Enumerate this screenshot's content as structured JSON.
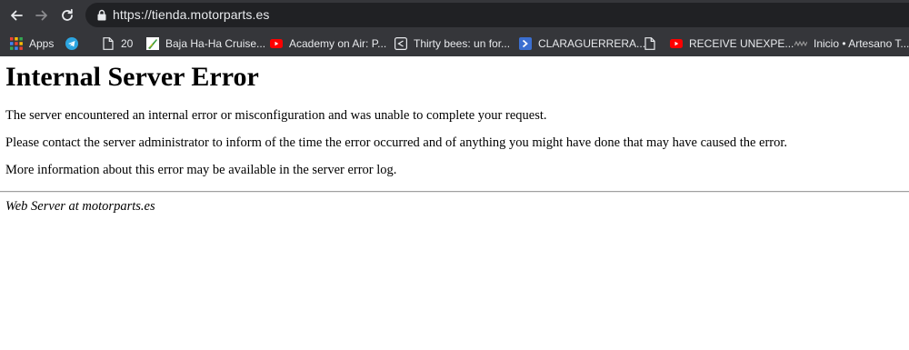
{
  "browser": {
    "url": "https://tienda.motorparts.es",
    "bookmarks": [
      {
        "label": "Apps",
        "icon": "apps-grid-icon"
      },
      {
        "label": "",
        "icon": "telegram-icon"
      },
      {
        "label": "20",
        "icon": "document-icon"
      },
      {
        "label": "Baja Ha-Ha Cruise...",
        "icon": "bajahaha-icon"
      },
      {
        "label": "Academy on Air: P...",
        "icon": "youtube-icon"
      },
      {
        "label": "Thirty bees: un for...",
        "icon": "share-icon"
      },
      {
        "label": "CLARAGUERRERA...",
        "icon": "chevron-icon"
      },
      {
        "label": "",
        "icon": "document-icon"
      },
      {
        "label": "RECEIVE UNEXPE...",
        "icon": "youtube-icon"
      },
      {
        "label": "Inicio • Artesano T...",
        "icon": "artesano-icon"
      }
    ]
  },
  "page": {
    "title": "Internal Server Error",
    "paragraphs": [
      "The server encountered an internal error or misconfiguration and was unable to complete your request.",
      "Please contact the server administrator to inform of the time the error occurred and of anything you might have done that may have caused the error.",
      "More information about this error may be available in the server error log."
    ],
    "address": "Web Server at motorparts.es"
  },
  "colors": {
    "chrome_bg": "#35363a",
    "omnibox_bg": "#202124",
    "chrome_text": "#e8eaed",
    "youtube_red": "#ff0000",
    "telegram_blue": "#2ca5e0"
  }
}
